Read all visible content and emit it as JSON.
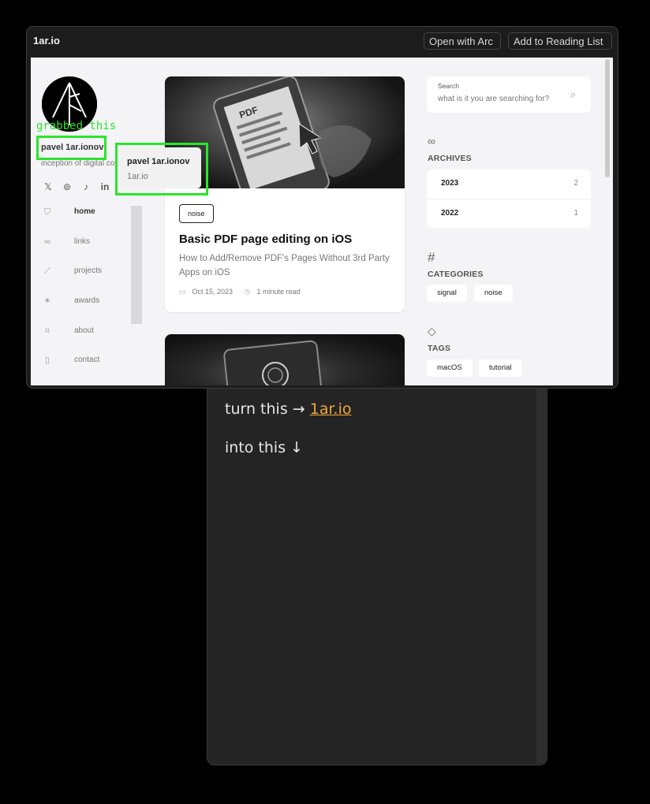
{
  "note": {
    "line1_prefix": "turn this → ",
    "line1_link": "1ar.io",
    "line2": "into this ↓"
  },
  "window": {
    "title": "1ar.io",
    "open_with_arc": "Open with Arc",
    "add_to_reading_list": "Add to Reading List"
  },
  "sidebar": {
    "author_name": "pavel 1ar.ionov",
    "tagline": "inception of digital co",
    "social": [
      "𝕏",
      "⊚",
      "♪",
      "in"
    ],
    "nav": [
      {
        "label": "home",
        "icon": "shield-icon"
      },
      {
        "label": "links",
        "icon": "link-icon"
      },
      {
        "label": "projects",
        "icon": "chart-icon"
      },
      {
        "label": "awards",
        "icon": "star-icon"
      },
      {
        "label": "about",
        "icon": "face-scan-icon"
      },
      {
        "label": "contact",
        "icon": "contact-card-icon"
      }
    ]
  },
  "article": {
    "tag": "noise",
    "title": "Basic PDF page editing on iOS",
    "subtitle": "How to Add/Remove PDF's Pages Without 3rd Party Apps on iOS",
    "date": "Oct 15, 2023",
    "read_time": "1 minute read"
  },
  "search": {
    "label": "Search",
    "placeholder": "what is it you are searching for?"
  },
  "archives": {
    "title": "ARCHIVES",
    "items": [
      {
        "year": "2023",
        "count": "2"
      },
      {
        "year": "2022",
        "count": "1"
      }
    ]
  },
  "categories": {
    "title": "CATEGORIES",
    "items": [
      "signal",
      "noise"
    ]
  },
  "tags": {
    "title": "TAGS",
    "items": [
      "macOS",
      "tutorial"
    ]
  },
  "tooltip": {
    "title": "pavel 1ar.ionov",
    "subtitle": "1ar.io"
  },
  "annotation": {
    "label": "grabbed this"
  },
  "colors": {
    "highlight": "#2ae52a",
    "link": "#f3a73a"
  }
}
